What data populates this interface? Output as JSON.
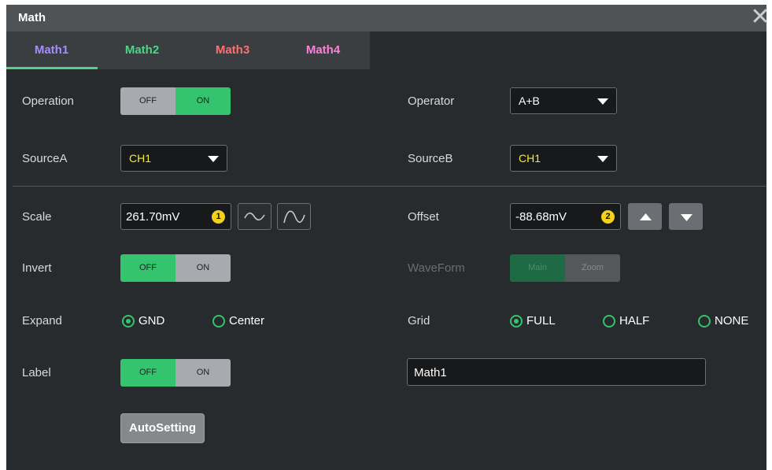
{
  "window": {
    "title": "Math"
  },
  "tabs": [
    {
      "label": "Math1",
      "color": "#a58dff"
    },
    {
      "label": "Math2",
      "color": "#4fd387"
    },
    {
      "label": "Math3",
      "color": "#ff6f6f"
    },
    {
      "label": "Math4",
      "color": "#ff80d8"
    }
  ],
  "active_tab": "Math1",
  "operation": {
    "label": "Operation",
    "off": "OFF",
    "on": "ON",
    "state": "ON"
  },
  "operator": {
    "label": "Operator",
    "value": "A+B"
  },
  "sourceA": {
    "label": "SourceA",
    "value": "CH1"
  },
  "sourceB": {
    "label": "SourceB",
    "value": "CH1"
  },
  "scale": {
    "label": "Scale",
    "value": "261.70mV",
    "knob": "1"
  },
  "offset": {
    "label": "Offset",
    "value": "-88.68mV",
    "knob": "2"
  },
  "invert": {
    "label": "Invert",
    "off": "OFF",
    "on": "ON",
    "state": "OFF"
  },
  "waveform": {
    "label": "WaveForm",
    "main": "Main",
    "zoom": "Zoom",
    "state": "Main",
    "enabled": false
  },
  "expand": {
    "label": "Expand",
    "options": [
      "GND",
      "Center"
    ],
    "selected": "GND"
  },
  "grid": {
    "label": "Grid",
    "options": [
      "FULL",
      "HALF",
      "NONE"
    ],
    "selected": "FULL"
  },
  "label_row": {
    "label": "Label",
    "off": "OFF",
    "on": "ON",
    "state": "OFF",
    "text_value": "Math1"
  },
  "autosetting": {
    "label": "AutoSetting"
  },
  "colors": {
    "accent": "#35c46e",
    "channel_yellow": "#f3ec2b"
  }
}
